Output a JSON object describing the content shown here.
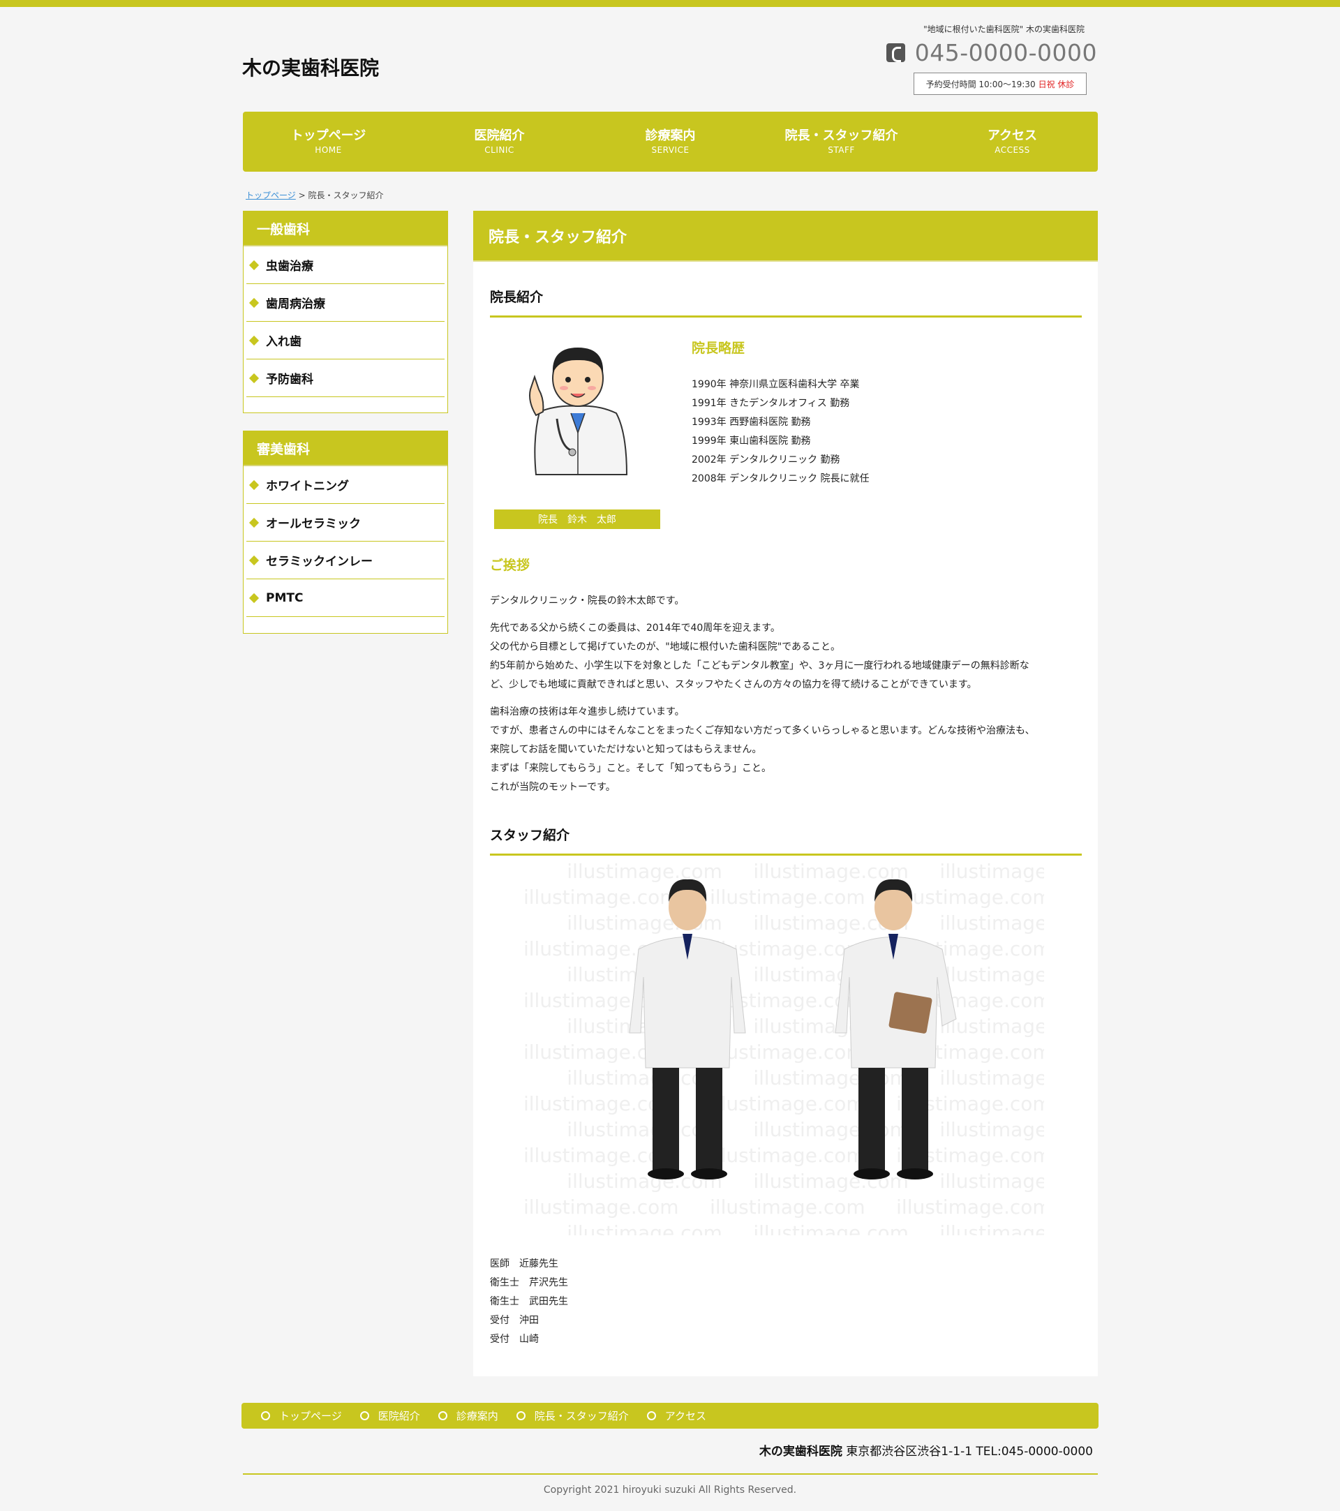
{
  "header": {
    "logo": "木の実歯科医院",
    "tagline": "\"地域に根付いた歯科医院\" 木の実歯科医院",
    "phone": "045-0000-0000",
    "hours_label": "予約受付時間 10:00～19:30",
    "holiday": "日祝 休診"
  },
  "nav": [
    {
      "jp": "トップページ",
      "en": "HOME"
    },
    {
      "jp": "医院紹介",
      "en": "CLINIC"
    },
    {
      "jp": "診療案内",
      "en": "SERVICE"
    },
    {
      "jp": "院長・スタッフ紹介",
      "en": "STAFF"
    },
    {
      "jp": "アクセス",
      "en": "ACCESS"
    }
  ],
  "breadcrumb": {
    "home": "トップページ",
    "sep": " > ",
    "current": "院長・スタッフ紹介"
  },
  "sidebar": [
    {
      "title": "一般歯科",
      "items": [
        "虫歯治療",
        "歯周病治療",
        "入れ歯",
        "予防歯科"
      ]
    },
    {
      "title": "審美歯科",
      "items": [
        "ホワイトニング",
        "オールセラミック",
        "セラミックインレー",
        "PMTC"
      ]
    }
  ],
  "main": {
    "title": "院長・スタッフ紹介",
    "director_section": "院長紹介",
    "caption": "院長　鈴木　太郎",
    "profile_heading": "院長略歴",
    "career": [
      "1990年 神奈川県立医科歯科大学 卒業",
      "1991年 きたデンタルオフィス 勤務",
      "1993年 西野歯科医院 勤務",
      "1999年 東山歯科医院 勤務",
      "2002年 デンタルクリニック 勤務",
      "2008年 デンタルクリニック 院長に就任"
    ],
    "greeting_heading": "ご挨拶",
    "greeting": [
      [
        "デンタルクリニック・院長の鈴木太郎です。"
      ],
      [
        "先代である父から続くこの委員は、2014年で40周年を迎えます。",
        "父の代から目標として掲げていたのが、\"地域に根付いた歯科医院\"であること。",
        "約5年前から始めた、小学生以下を対象とした「こどもデンタル教室」や、3ヶ月に一度行われる地域健康デーの無料診断な",
        "ど、少しでも地域に貢献できればと思い、スタッフやたくさんの方々の協力を得て続けることができています。"
      ],
      [
        "歯科治療の技術は年々進歩し続けています。",
        "ですが、患者さんの中にはそんなことをまったくご存知ない方だって多くいらっしゃると思います。どんな技術や治療法も、",
        "来院してお話を聞いていただけないと知ってはもらえません。",
        "まずは「来院してもらう」こと。そして「知ってもらう」こと。",
        "これが当院のモットーです。"
      ]
    ],
    "staff_section": "スタッフ紹介",
    "watermark_text": "illustimage.com",
    "staff": [
      "医師　近藤先生",
      "衛生士　芹沢先生",
      "衛生士　武田先生",
      "受付　沖田",
      "受付　山崎"
    ]
  },
  "footer": {
    "nav": [
      "トップページ",
      "医院紹介",
      "診療案内",
      "院長・スタッフ紹介",
      "アクセス"
    ],
    "clinic_name": "木の実歯科医院",
    "address": "東京都渋谷区渋谷1-1-1 TEL:045-0000-0000",
    "copyright": "Copyright 2021 hiroyuki suzuki All Rights Reserved."
  },
  "colors": {
    "accent": "#c8c61f",
    "holiday": "#e02020",
    "link": "#3a8fd6"
  }
}
